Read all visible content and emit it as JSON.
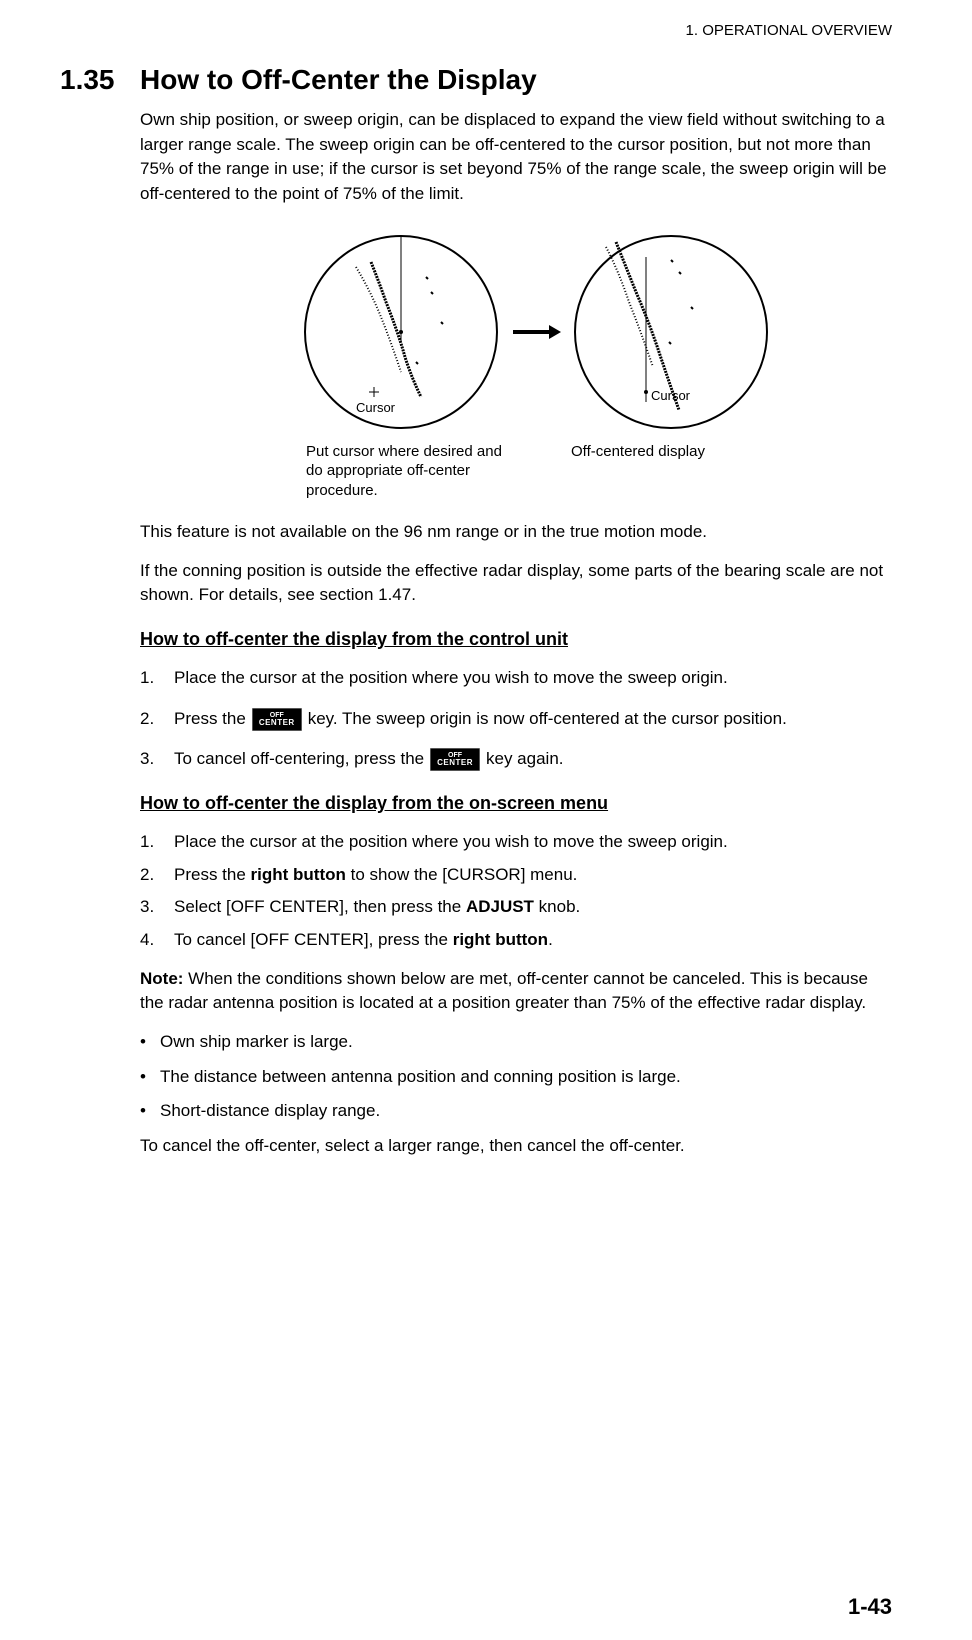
{
  "header": {
    "chapter": "1.  OPERATIONAL OVERVIEW"
  },
  "section": {
    "number": "1.35",
    "title": "How to Off-Center the Display"
  },
  "intro_para": "Own ship position, or sweep origin, can be displaced to expand the view field without switching to a larger range scale. The sweep origin can be off-centered to the cursor position, but not more than 75% of the range in use; if the cursor is set beyond 75% of the range scale, the sweep origin will be off-centered to the point of 75% of the limit.",
  "diagram": {
    "left_label": "Cursor",
    "right_label": "Cursor",
    "caption_left": "Put cursor where desired and do appropriate off-center procedure.",
    "caption_right": "Off-centered display"
  },
  "after_diagram_para1": "This feature is not available on the 96 nm range or in the true motion mode.",
  "after_diagram_para2": "If the conning position is outside the effective radar display, some parts of the bearing scale are not shown. For details, see section 1.47.",
  "subheading1": "How to off-center the display from the control unit",
  "control_unit_steps": {
    "s1": "Place the cursor at the position where you wish to move the sweep origin.",
    "s2_pre": "Press the",
    "s2_post": "key. The sweep origin is now off-centered at the cursor position.",
    "s3_pre": "To cancel off-centering, press the",
    "s3_post": "key again."
  },
  "key_label_top": "OFF",
  "key_label_bottom": "CENTER",
  "subheading2": "How to off-center the display from the on-screen menu",
  "onscreen_steps": {
    "s1": "Place the cursor at the position where you wish to move the sweep origin.",
    "s2_pre": "Press the ",
    "s2_bold": "right button",
    "s2_post": " to show the [CURSOR] menu.",
    "s3_pre": "Select [OFF CENTER], then press the ",
    "s3_bold": "ADJUST",
    "s3_post": " knob.",
    "s4_pre": "To cancel [OFF CENTER], press the ",
    "s4_bold": "right button",
    "s4_post": "."
  },
  "note_label": "Note:",
  "note_body": " When the conditions shown below are met, off-center cannot be canceled. This is because the radar antenna position is located at a position greater than 75% of the effective radar display.",
  "bullets": {
    "b1": "Own ship marker is large.",
    "b2": "The distance between antenna position and conning position is large.",
    "b3": "Short-distance display range."
  },
  "closing_para": "To cancel the off-center, select a larger range, then cancel the off-center.",
  "page_number": "1-43"
}
